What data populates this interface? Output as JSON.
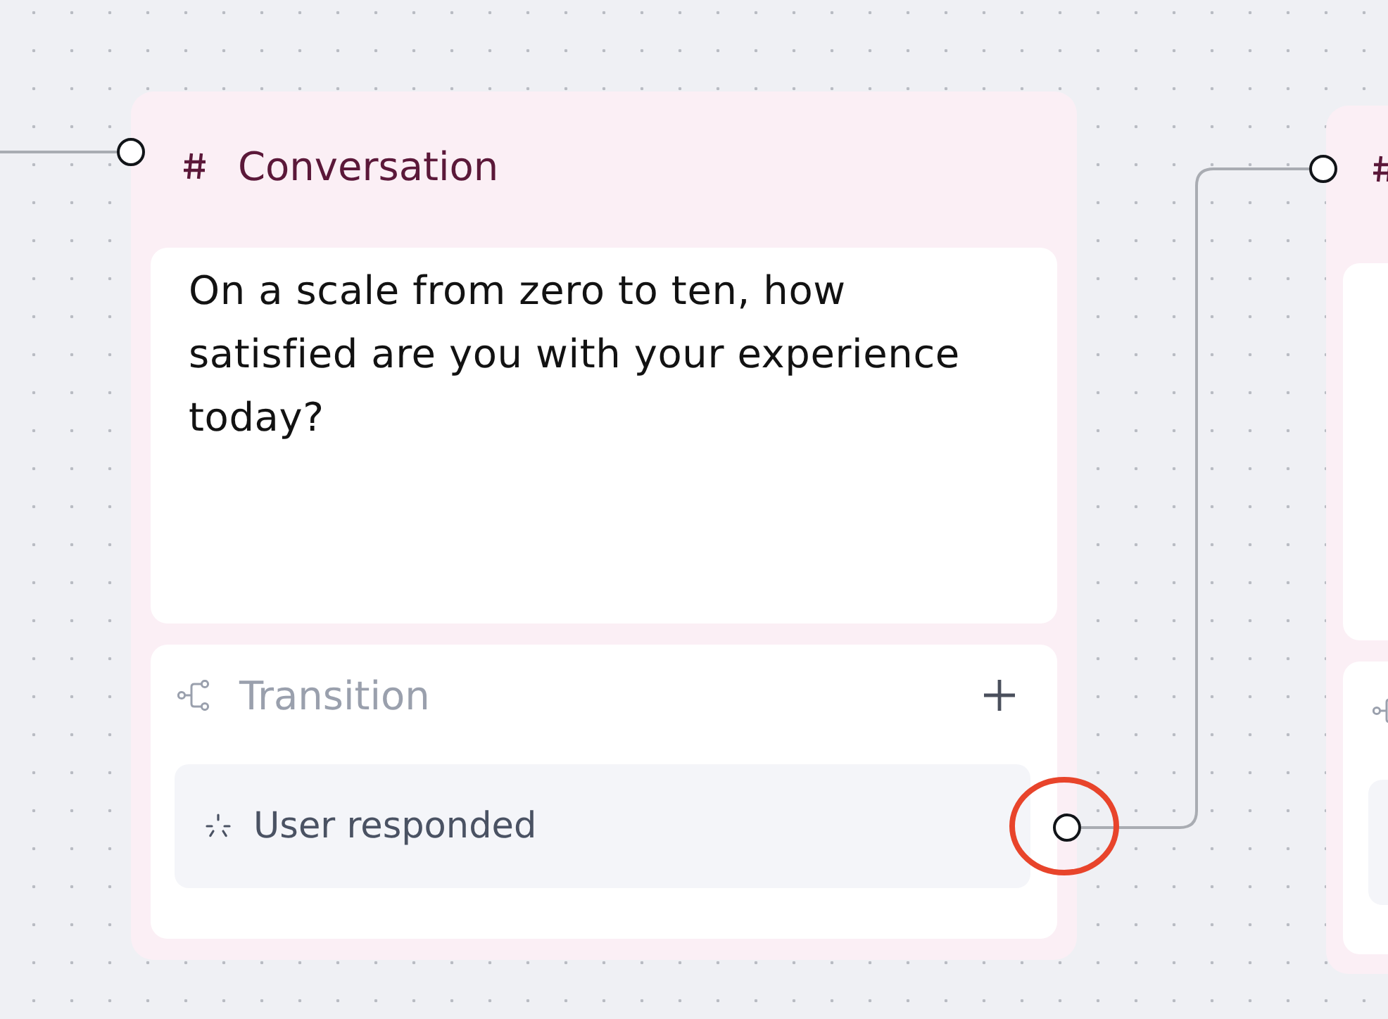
{
  "canvas": {
    "nodes": [
      {
        "kind": "conversation",
        "title": "Conversation",
        "prompt": "On a scale from zero to ten, how satisfied are you with your experience today?",
        "transition": {
          "label": "Transition",
          "items": [
            {
              "label": "User responded",
              "highlighted": true
            }
          ]
        }
      },
      {
        "kind": "conversation_clipped"
      }
    ]
  }
}
